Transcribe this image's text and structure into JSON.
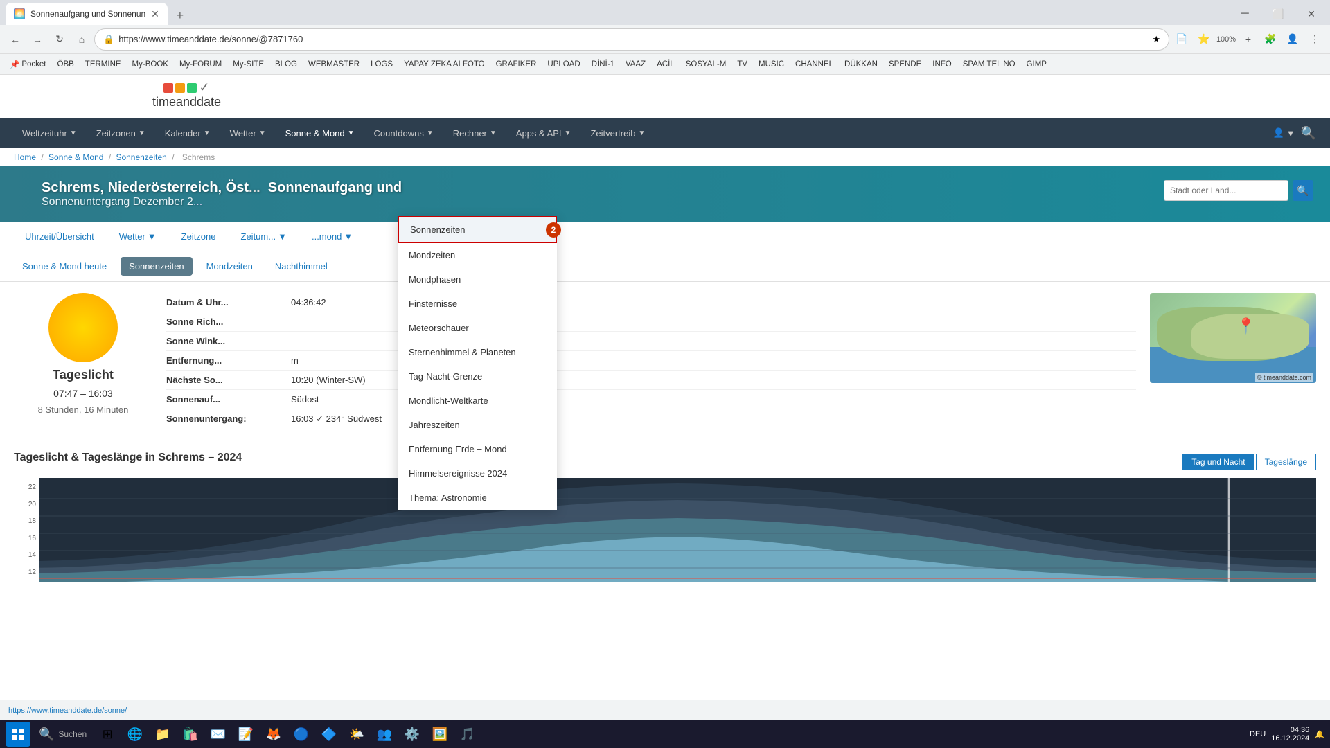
{
  "browser": {
    "tab": {
      "title": "Sonnenaufgang und Sonnenun",
      "favicon": "🌅"
    },
    "url": "https://www.timeanddate.de/sonne/@7871760",
    "zoom": "100%"
  },
  "bookmarks": [
    {
      "label": "Pocket",
      "icon": "📌"
    },
    {
      "label": "ÖBB",
      "icon": "🚂"
    },
    {
      "label": "TERMINE",
      "icon": "📅"
    },
    {
      "label": "My-BOOK",
      "icon": "📚"
    },
    {
      "label": "My-FORUM",
      "icon": "💬"
    },
    {
      "label": "My-SITE",
      "icon": "🌐"
    },
    {
      "label": "BLOG",
      "icon": "✏️"
    },
    {
      "label": "WEBMASTER",
      "icon": "⚙️"
    },
    {
      "label": "LOGS",
      "icon": "📋"
    },
    {
      "label": "YAPAY ZEKA AI FOTO",
      "icon": "🤖"
    },
    {
      "label": "GRAFIKER",
      "icon": "🎨"
    },
    {
      "label": "UPLOAD",
      "icon": "⬆️"
    },
    {
      "label": "DİNİ-1",
      "icon": "☪️"
    },
    {
      "label": "VAAZ",
      "icon": "🕌"
    },
    {
      "label": "ACİL",
      "icon": "🚨"
    },
    {
      "label": "SOSYAL-M",
      "icon": "👥"
    },
    {
      "label": "TV",
      "icon": "📺"
    },
    {
      "label": "MUSIC",
      "icon": "🎵"
    },
    {
      "label": "CHANNEL",
      "icon": "📡"
    },
    {
      "label": "DÜKKAN",
      "icon": "🛒"
    },
    {
      "label": "SPENDE",
      "icon": "💝"
    },
    {
      "label": "INFO",
      "icon": "ℹ️"
    },
    {
      "label": "SPAM TEL NO",
      "icon": "📞"
    },
    {
      "label": "GIMP",
      "icon": "🖼️"
    }
  ],
  "site": {
    "logo_text": "timeanddate",
    "nav": [
      {
        "label": "Weltzeituhr",
        "dropdown": true
      },
      {
        "label": "Zeitzonen",
        "dropdown": true
      },
      {
        "label": "Kalender",
        "dropdown": true
      },
      {
        "label": "Wetter",
        "dropdown": true
      },
      {
        "label": "Sonne & Mond",
        "dropdown": true,
        "active": true
      },
      {
        "label": "Countdowns",
        "dropdown": true
      },
      {
        "label": "Rechner",
        "dropdown": true
      },
      {
        "label": "Apps & API",
        "dropdown": true
      },
      {
        "label": "Zeitvertreib",
        "dropdown": true
      }
    ],
    "breadcrumbs": [
      "Home",
      "Sonne & Mond",
      "Sonnenzeiten",
      "Schrems"
    ],
    "hero": {
      "title": "Schrems, Niederösterreich, Öst...",
      "subtitle": "Sonnenaufgang und",
      "date": "Sonnenuntergang Dezember 2...",
      "search_placeholder": "Stadt oder Land..."
    },
    "tabs": [
      {
        "label": "Uhrzeit/Übersicht"
      },
      {
        "label": "Wetter",
        "dropdown": true
      },
      {
        "label": "Zeitzone"
      },
      {
        "label": "Zeitum...",
        "dropdown": true
      },
      {
        "label": "...mond",
        "dropdown": true
      }
    ],
    "sub_tabs": [
      {
        "label": "Sonne & Mond heute"
      },
      {
        "label": "Sonnenzeiten",
        "active": true
      },
      {
        "label": "Mondzeiten"
      },
      {
        "label": "Nachthimmel"
      }
    ],
    "info": {
      "datum_label": "Datum & Uhr...",
      "datum_value": "04:36:42",
      "richtung_label": "Sonne Rich...",
      "winkel_label": "Sonne Wink...",
      "entfernung_label": "Entfernung...",
      "entfernung_value": "m",
      "naechste_label": "Nächste So...",
      "naechste_value": "10:20 (Winter-SW)",
      "sonnenauf_label": "Sonnenauf...",
      "sonnenauf_value": "Südost",
      "sonnenunter_label": "Sonnenuntergang:",
      "sonnenunter_value": "16:03 ✓ 234° Südwest"
    },
    "sun": {
      "label": "Tageslicht",
      "time_range": "07:47 – 16:03",
      "duration": "8 Stunden, 16 Minuten"
    },
    "chart": {
      "title": "Tageslicht & Tageslänge in Schrems – 2024",
      "buttons": [
        "Tag und Nacht",
        "Tageslänge"
      ],
      "active_button": "Tag und Nacht",
      "y_labels": [
        "22",
        "20",
        "18",
        "16",
        "14",
        "12"
      ]
    },
    "dropdown": {
      "items": [
        {
          "label": "Sonnenzeiten",
          "highlighted": true,
          "badge": "2"
        },
        {
          "label": "Mondzeiten"
        },
        {
          "label": "Mondphasen"
        },
        {
          "label": "Finsternisse"
        },
        {
          "label": "Meteorschauer"
        },
        {
          "label": "Sternenhimmel & Planeten"
        },
        {
          "label": "Tag-Nacht-Grenze"
        },
        {
          "label": "Mondlicht-Weltkarte"
        },
        {
          "label": "Jahreszeiten"
        },
        {
          "label": "Entfernung Erde – Mond"
        },
        {
          "label": "Himmelsereignisse 2024"
        },
        {
          "label": "Thema: Astronomie"
        }
      ]
    }
  },
  "status_bar": {
    "url": "https://www.timeanddate.de/sonne/"
  },
  "taskbar": {
    "time": "04:36",
    "date": "16.12.2024",
    "language": "DEU"
  }
}
